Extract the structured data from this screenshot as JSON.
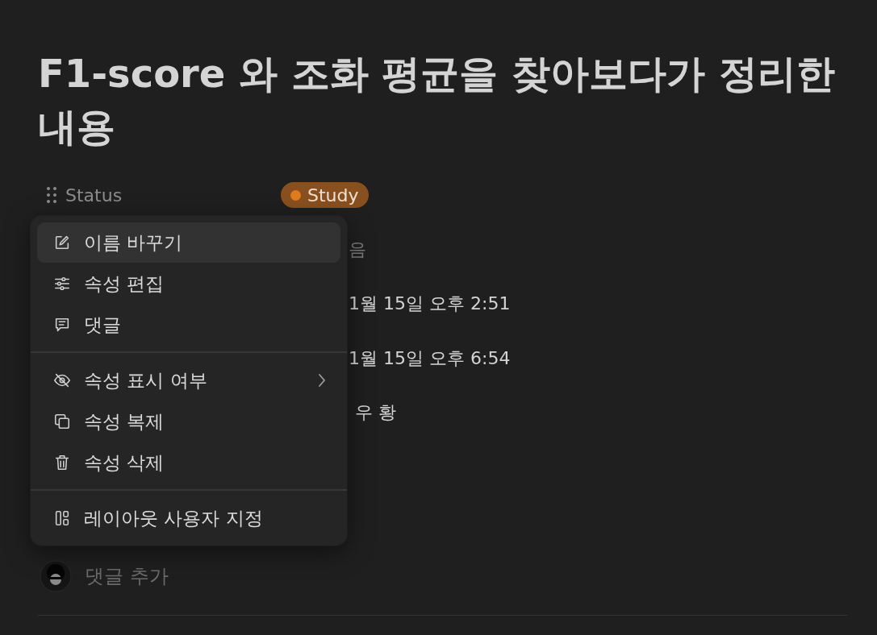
{
  "title": "F1-score 와 조화 평균을 찾아보다가 정리한 내용",
  "properties": [
    {
      "label": "Status",
      "value": {
        "kind": "tag",
        "text": "Study"
      }
    }
  ],
  "partly_hidden_values": [
    "음",
    "1월 15일 오후 2:51",
    "1월 15일 오후 6:54",
    "우 황"
  ],
  "comment_box": {
    "placeholder": "댓글 추가"
  },
  "menu": {
    "groups": [
      [
        {
          "label": "이름 바꾸기",
          "selected": true,
          "submenu": false
        },
        {
          "label": "속성 편집",
          "selected": false,
          "submenu": false
        },
        {
          "label": "댓글",
          "selected": false,
          "submenu": false
        }
      ],
      [
        {
          "label": "속성 표시 여부",
          "selected": false,
          "submenu": true
        },
        {
          "label": "속성 복제",
          "selected": false,
          "submenu": false
        },
        {
          "label": "속성 삭제",
          "selected": false,
          "submenu": false
        }
      ],
      [
        {
          "label": "레이아웃 사용자 지정",
          "selected": false,
          "submenu": false
        }
      ]
    ]
  }
}
